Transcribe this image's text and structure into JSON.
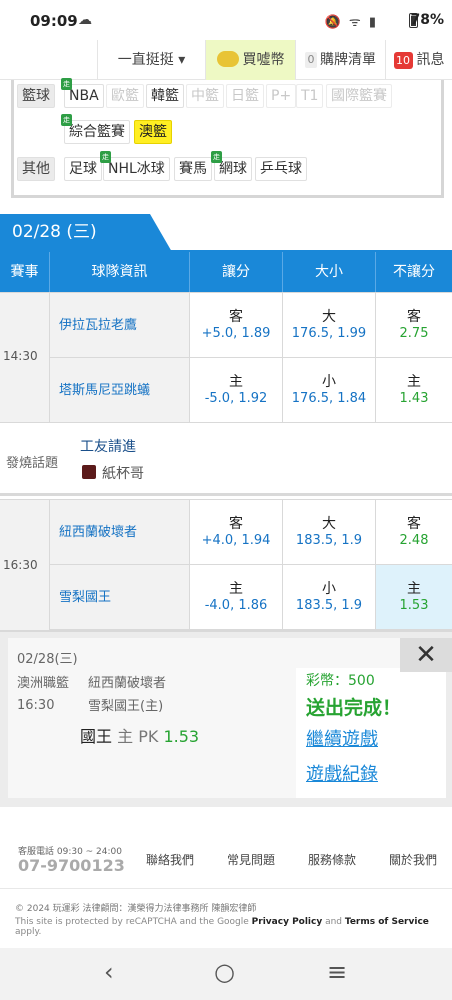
{
  "status_bar": {
    "time": "09:09",
    "battery": "78%"
  },
  "top_nav": {
    "item1": "一直挺挺 ▾",
    "item2": "買噓幣",
    "item3_count": "0",
    "item3": "購牌清單",
    "item4_count": "10",
    "item4": "訊息"
  },
  "sport_tags": {
    "basketball_label": "籃球",
    "row1": [
      "NBA",
      "歐籃",
      "韓籃",
      "中籃",
      "日籃",
      "P+",
      "T1",
      "國際籃賽"
    ],
    "row2": [
      "綜合籃賽",
      "澳籃"
    ],
    "other_label": "其他",
    "row3": [
      "足球",
      "NHL冰球",
      "賽馬",
      "網球",
      "乒乓球"
    ],
    "zou_badge": "走"
  },
  "date_tab": "02/28 (三)",
  "table_header": {
    "event": "賽事",
    "team": "球隊資訊",
    "spread": "讓分",
    "total": "大小",
    "moneyline": "不讓分"
  },
  "games": [
    {
      "time": "14:30",
      "away": {
        "team": "伊拉瓦拉老鷹",
        "spread_label": "客",
        "spread": "+5.0, 1.89",
        "total_label": "大",
        "total": "176.5, 1.99",
        "ml_label": "客",
        "ml": "2.75"
      },
      "home": {
        "team": "塔斯馬尼亞跳蟻",
        "spread_label": "主",
        "spread": "-5.0, 1.92",
        "total_label": "小",
        "total": "176.5, 1.84",
        "ml_label": "主",
        "ml": "1.43"
      }
    },
    {
      "time": "16:30",
      "away": {
        "team": "紐西蘭破壞者",
        "spread_label": "客",
        "spread": "+4.0, 1.94",
        "total_label": "大",
        "total": "183.5, 1.9",
        "ml_label": "客",
        "ml": "2.48"
      },
      "home": {
        "team": "雪梨國王",
        "spread_label": "主",
        "spread": "-4.0, 1.86",
        "total_label": "小",
        "total": "183.5, 1.9",
        "ml_label": "主",
        "ml": "1.53"
      }
    }
  ],
  "hot_topic": {
    "label": "發燒話題",
    "title": "工友請進",
    "user": "紙杯哥"
  },
  "popup": {
    "date": "02/28(三)",
    "league": "澳洲職籃",
    "time": "16:30",
    "team1": "紐西蘭破壞者",
    "team2": "雪梨國王(主)",
    "pick_team": "國王",
    "pick_side": "主",
    "pick_type": "PK",
    "pick_odds": "1.53",
    "coins": "彩幣：500",
    "sent": "送出完成！",
    "continue": "繼續遊戲",
    "history": "遊戲紀錄",
    "close": "✕"
  },
  "footer": {
    "phone_label": "客服電話 09:30 ~ 24:00",
    "phone": "07-9700123",
    "links": [
      "聯絡我們",
      "常見問題",
      "服務條款",
      "關於我們"
    ],
    "copyright": "© 2024 玩運彩  法律顧問：漢榮得力法律事務所 陳韻宏律師",
    "recaptcha_pre": "This site is protected by reCAPTCHA and the Google ",
    "privacy": "Privacy Policy",
    "and": " and ",
    "terms": "Terms of Service",
    "apply": " apply."
  },
  "android_nav": {
    "back": "‹",
    "home": "○",
    "recents": "≡"
  }
}
